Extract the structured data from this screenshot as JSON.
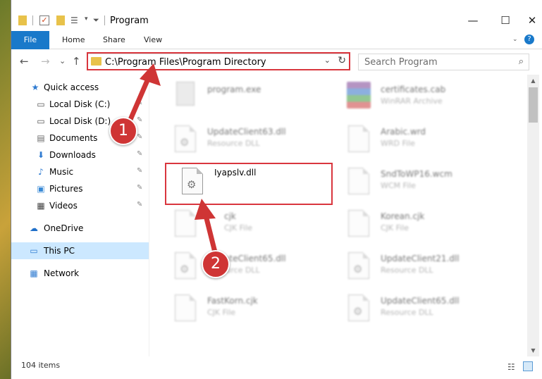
{
  "window": {
    "title": "Program",
    "minimize": "—",
    "maximize": "☐",
    "close": "✕"
  },
  "ribbon": {
    "tabs": [
      "File",
      "Home",
      "Share",
      "View"
    ],
    "help": "?"
  },
  "nav": {
    "back": "←",
    "forward": "→",
    "recent": "⌄",
    "up": "↑",
    "address": "C:\\Program Files\\Program Directory",
    "address_chevron": "⌄",
    "refresh": "↻",
    "search_placeholder": "Search Program",
    "search_icon": "⌕"
  },
  "sidebar": {
    "items": [
      {
        "label": "Quick access",
        "icon": "star-icon",
        "glyph": "★",
        "color": "#2f7bd1"
      },
      {
        "label": "Local Disk (C:)",
        "icon": "drive-icon",
        "glyph": "▭",
        "color": "#555555",
        "pinned": true
      },
      {
        "label": "Local Disk (D:)",
        "icon": "drive-icon",
        "glyph": "▭",
        "color": "#555555",
        "pinned": true
      },
      {
        "label": "Documents",
        "icon": "documents-icon",
        "glyph": "▤",
        "color": "#6b6b6b",
        "pinned": true
      },
      {
        "label": "Downloads",
        "icon": "downloads-icon",
        "glyph": "⬇",
        "color": "#2f7bd1",
        "pinned": true
      },
      {
        "label": "Music",
        "icon": "music-icon",
        "glyph": "♪",
        "color": "#2f7bd1",
        "pinned": true
      },
      {
        "label": "Pictures",
        "icon": "pictures-icon",
        "glyph": "▣",
        "color": "#3a8ad6",
        "pinned": true
      },
      {
        "label": "Videos",
        "icon": "videos-icon",
        "glyph": "▦",
        "color": "#444444",
        "pinned": true
      },
      {
        "label": "OneDrive",
        "icon": "cloud-icon",
        "glyph": "☁",
        "color": "#1f6fc9"
      },
      {
        "label": "This PC",
        "icon": "computer-icon",
        "glyph": "▭",
        "color": "#2f7bd1",
        "selected": true
      },
      {
        "label": "Network",
        "icon": "network-icon",
        "glyph": "▦",
        "color": "#2f7bd1"
      }
    ],
    "pin_glyph": "📌"
  },
  "files": [
    {
      "name": "program.exe",
      "type": "",
      "icon": "exe-icon"
    },
    {
      "name": "certificates.cab",
      "type": "WinRAR Archive",
      "icon": "archive-icon"
    },
    {
      "name": "UpdateClient63.dll",
      "type": "Resource DLL",
      "icon": "dll-icon"
    },
    {
      "name": "Arabic.wrd",
      "type": "WRD File",
      "icon": "file-icon"
    },
    {
      "name": "Iyapslv.dll",
      "type": "",
      "icon": "dll-icon",
      "highlighted": true
    },
    {
      "name": "SndToWP16.wcm",
      "type": "WCM File",
      "icon": "file-icon"
    },
    {
      "name": "cjk",
      "type": "CJK File",
      "icon": "file-icon"
    },
    {
      "name": "Korean.cjk",
      "type": "CJK File",
      "icon": "file-icon"
    },
    {
      "name": "UpdateClient65.dll",
      "type": "Resource DLL",
      "icon": "dll-icon"
    },
    {
      "name": "UpdateClient21.dll",
      "type": "Resource DLL",
      "icon": "dll-icon"
    },
    {
      "name": "FastKorn.cjk",
      "type": "CJK File",
      "icon": "file-icon"
    },
    {
      "name": "UpdateClient65.dll",
      "type": "Resource DLL",
      "icon": "dll-icon"
    }
  ],
  "status": {
    "count": "104 items"
  },
  "annotations": {
    "step1": "1",
    "step2": "2",
    "color": "#d9363e"
  }
}
